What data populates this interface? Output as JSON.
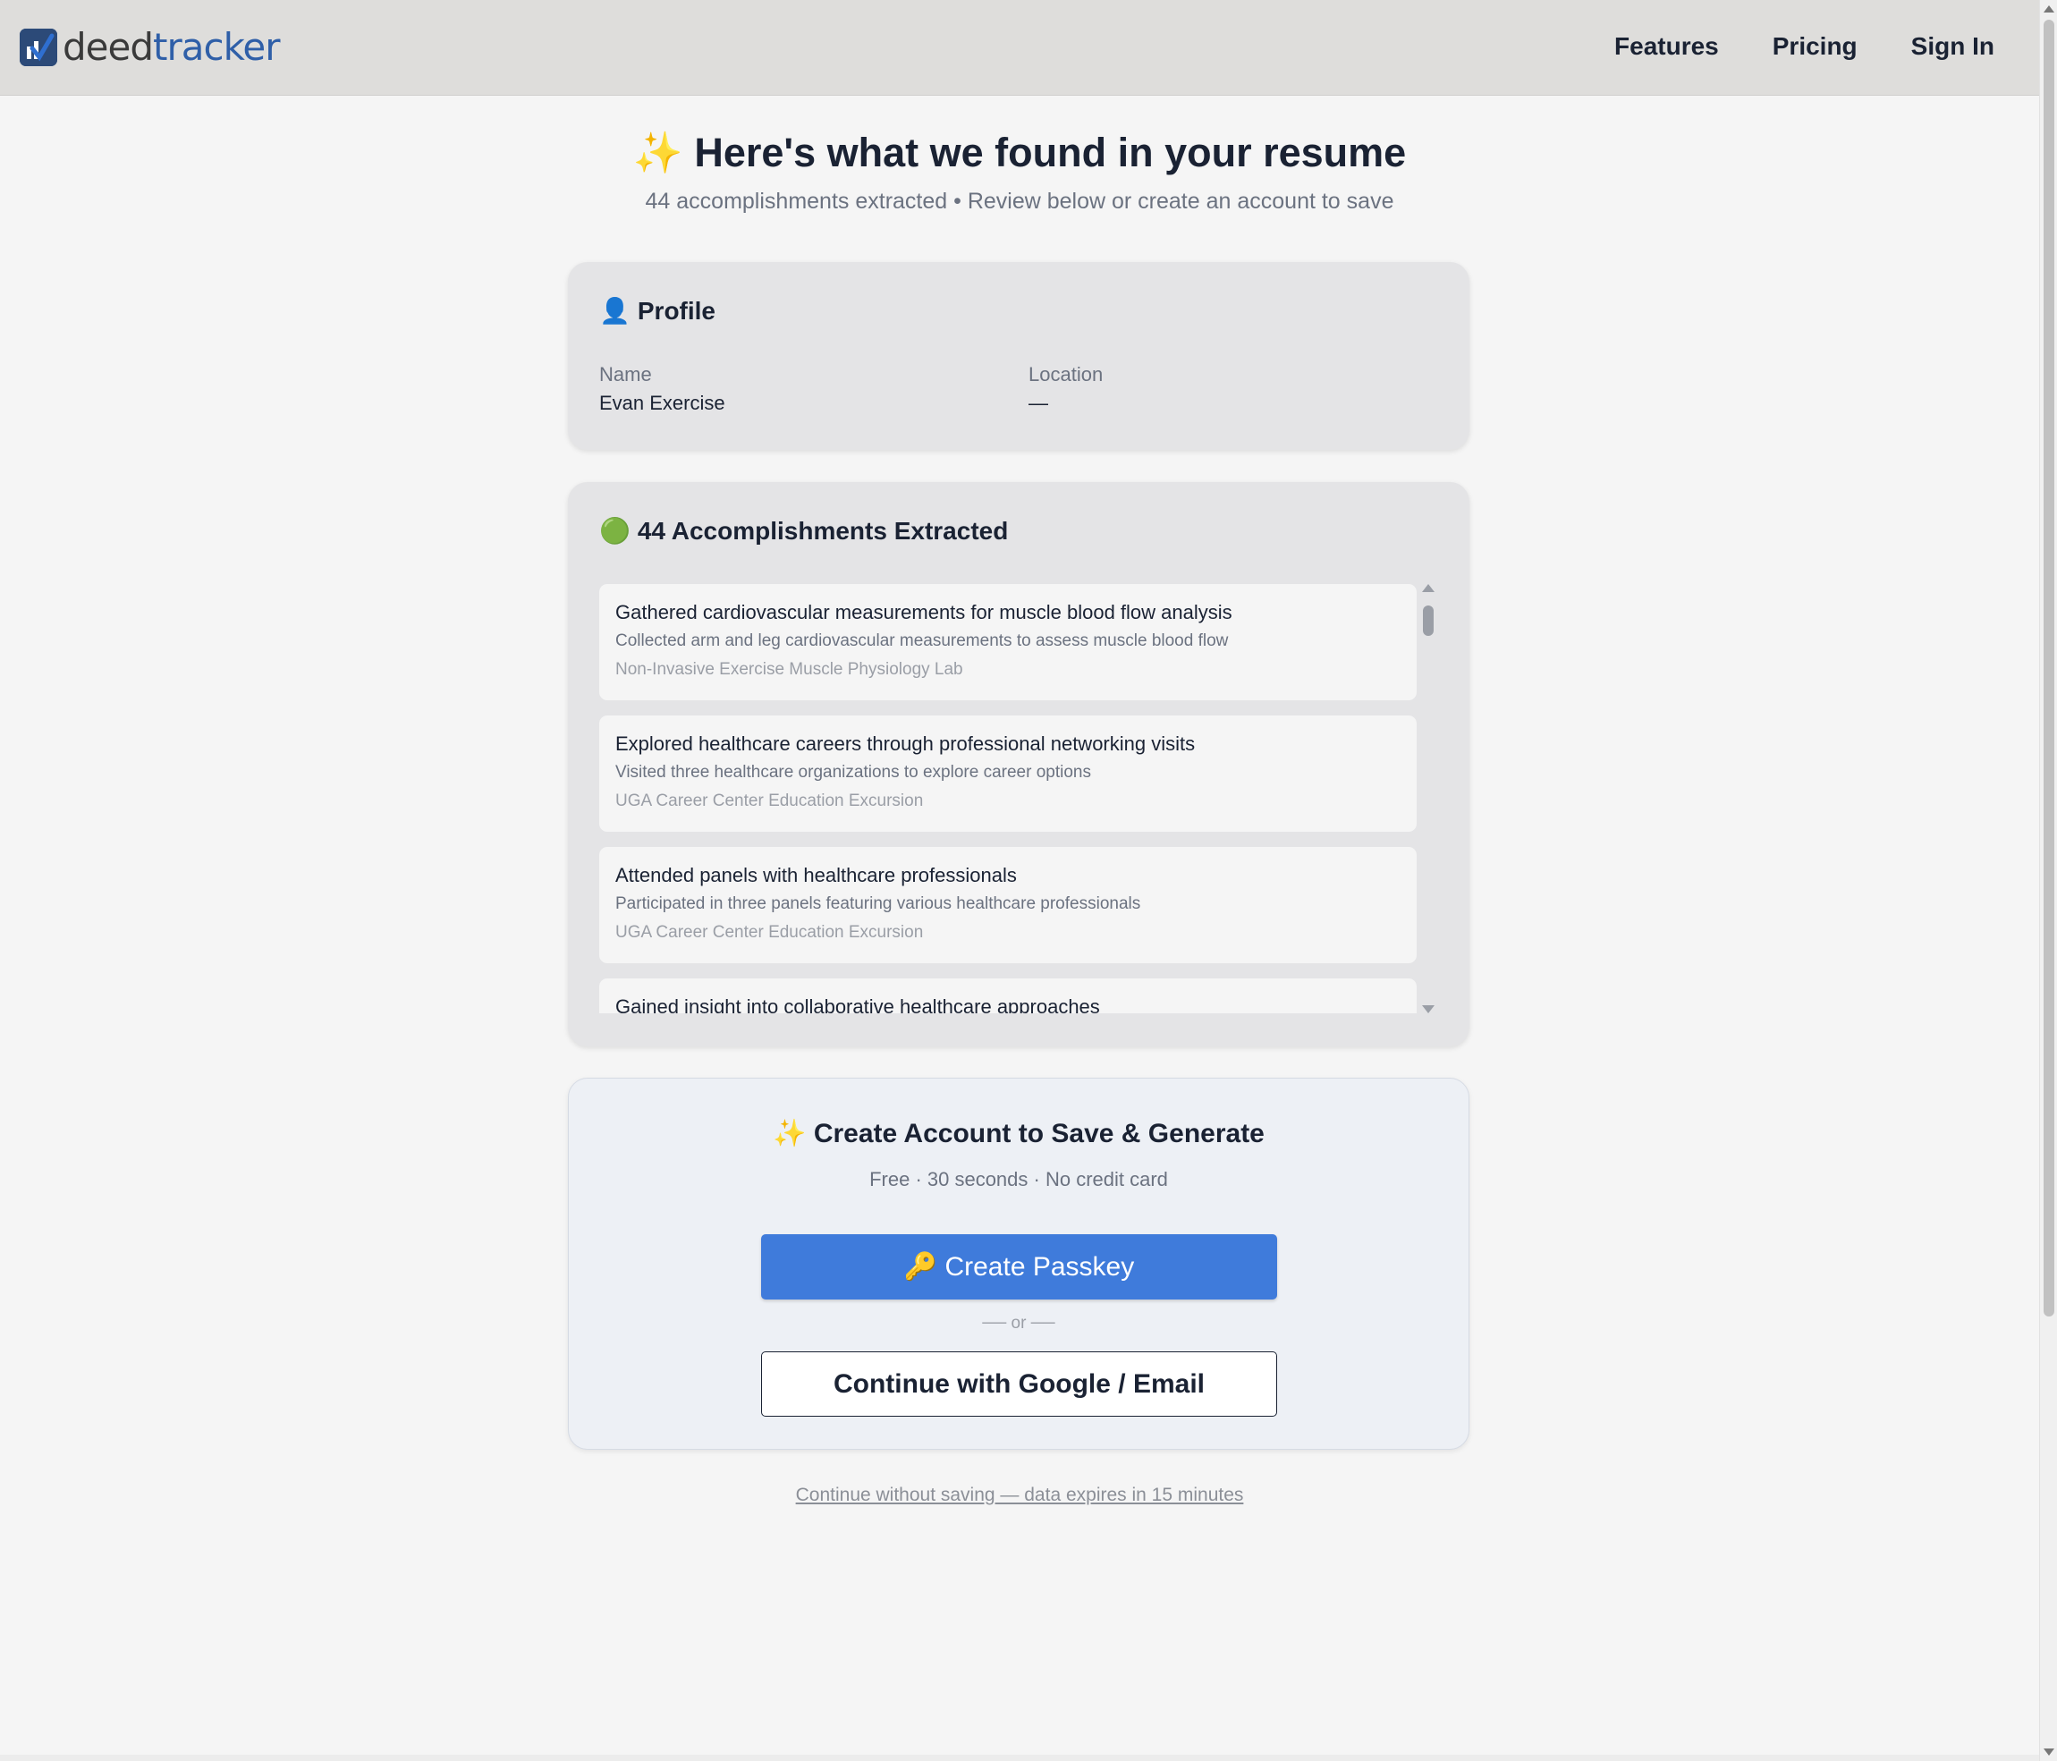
{
  "brand": {
    "name_part1": "deed",
    "name_part2": "tracker",
    "logo_icon": "check-chart-icon",
    "color": "#2f5fa8"
  },
  "nav": {
    "features": "Features",
    "pricing": "Pricing",
    "sign_in": "Sign In"
  },
  "hero": {
    "icon": "✨",
    "title": "Here's what we found in your resume",
    "subtitle": "44 accomplishments extracted • Review below or create an account to save"
  },
  "profile": {
    "icon": "👤",
    "title": "Profile",
    "name_label": "Name",
    "name_value": "Evan Exercise",
    "location_label": "Location",
    "location_value": "—"
  },
  "accomplishments": {
    "icon": "🟢",
    "title": "44 Accomplishments Extracted",
    "items": [
      {
        "title": "Gathered cardiovascular measurements for muscle blood flow analysis",
        "description": "Collected arm and leg cardiovascular measurements to assess muscle blood flow",
        "org": "Non-Invasive Exercise Muscle Physiology Lab"
      },
      {
        "title": "Explored healthcare careers through professional networking visits",
        "description": "Visited three healthcare organizations to explore career options",
        "org": "UGA Career Center Education Excursion"
      },
      {
        "title": "Attended panels with healthcare professionals",
        "description": "Participated in three panels featuring various healthcare professionals",
        "org": "UGA Career Center Education Excursion"
      },
      {
        "title": "Gained insight into collaborative healthcare approaches",
        "description": "",
        "org": ""
      }
    ]
  },
  "cta": {
    "icon": "✨",
    "title": "Create Account to Save & Generate",
    "subtitle": "Free · 30 seconds · No credit card",
    "passkey_icon": "🔑",
    "passkey_label": "Create Passkey",
    "or_text": "── or ──",
    "google_label": "Continue with Google / Email",
    "accent_color": "#3f7bdb"
  },
  "skip": {
    "label": "Continue without saving — data expires in 15 minutes"
  }
}
